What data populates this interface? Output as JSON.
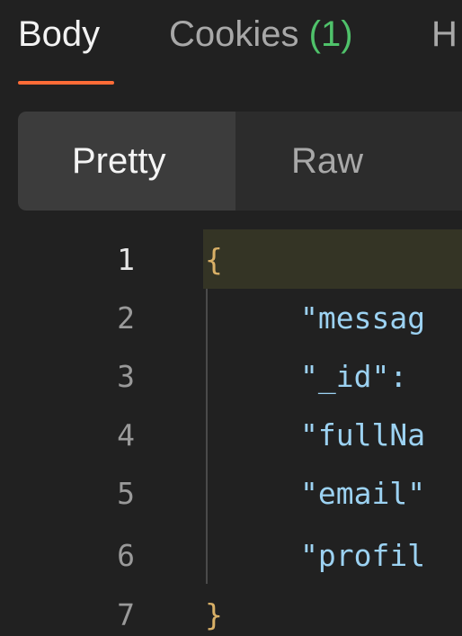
{
  "tabs": {
    "body_label": "Body",
    "cookies_label": "Cookies",
    "cookies_count": "(1)",
    "headers_label_partial": "H"
  },
  "view_modes": {
    "pretty_label": "Pretty",
    "raw_label": "Raw",
    "selected": "Pretty"
  },
  "editor": {
    "active_line": "1",
    "lines": [
      {
        "number": "1",
        "text": "{"
      },
      {
        "number": "2",
        "text": "\"messag"
      },
      {
        "number": "3",
        "text": "\"_id\":"
      },
      {
        "number": "4",
        "text": "\"fullNa"
      },
      {
        "number": "5",
        "text": "\"email\""
      },
      {
        "number": "6",
        "text": "\"profil"
      },
      {
        "number": "7",
        "text": "}"
      }
    ]
  },
  "colors": {
    "background": "#212121",
    "tab_underline": "#ff6c37",
    "cookies_count": "#4fc26a",
    "json_key": "#9cd2f2",
    "json_brace": "#d9b067"
  }
}
